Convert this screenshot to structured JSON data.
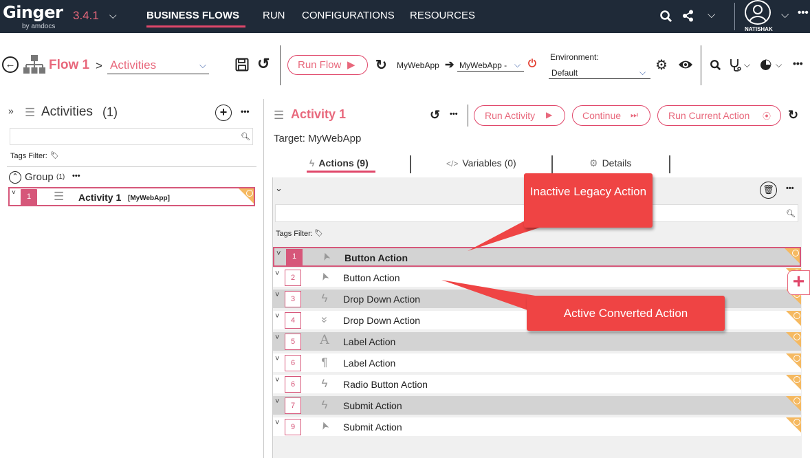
{
  "app": {
    "logo": "Ginger",
    "logo_sub": "by amdocs",
    "version": "3.4.1",
    "user": "NATISHAK"
  },
  "nav": {
    "items": [
      "BUSINESS FLOWS",
      "RUN",
      "CONFIGURATIONS",
      "RESOURCES"
    ]
  },
  "toolbar": {
    "flow_title": "Flow 1",
    "separator": ">",
    "view_select": "Activities",
    "run_flow": "Run Flow",
    "target_app": "MyWebApp",
    "agent_select": "MyWebApp -",
    "env_label": "Environment:",
    "env_value": "Default"
  },
  "activities_panel": {
    "title": "Activities",
    "count": "(1)",
    "tags_filter": "Tags Filter:",
    "group_name": "Group",
    "group_count": "(1)",
    "activity": {
      "num": "1",
      "name": "Activity 1",
      "target": "[MyWebApp]"
    }
  },
  "activity_detail": {
    "title": "Activity 1",
    "run_activity": "Run Activity",
    "continue": "Continue",
    "run_current_action": "Run Current Action",
    "target": "Target: MyWebApp",
    "tabs": {
      "actions": "Actions (9)",
      "variables": "Variables (0)",
      "details": "Details"
    },
    "tags_filter": "Tags Filter:"
  },
  "actions": [
    {
      "num": "1",
      "label": "Button Action",
      "icon": "cursor-icon",
      "style": "gray",
      "selected": true
    },
    {
      "num": "2",
      "label": "Button Action",
      "icon": "cursor-icon",
      "style": "white",
      "selected": false
    },
    {
      "num": "3",
      "label": "Drop Down Action",
      "icon": "bolt-icon",
      "style": "gray",
      "selected": false
    },
    {
      "num": "4",
      "label": "Drop Down Action",
      "icon": "double-chevron-icon",
      "style": "white",
      "selected": false
    },
    {
      "num": "5",
      "label": "Label Action",
      "icon": "letter-a-icon",
      "style": "gray",
      "selected": false
    },
    {
      "num": "6",
      "label": "Label Action",
      "icon": "pilcrow-icon",
      "style": "white",
      "selected": false
    },
    {
      "num": "6",
      "label": "Radio Button Action",
      "icon": "bolt-icon",
      "style": "white",
      "selected": false
    },
    {
      "num": "7",
      "label": "Submit Action",
      "icon": "bolt-icon",
      "style": "gray",
      "selected": false
    },
    {
      "num": "9",
      "label": "Submit Action",
      "icon": "cursor-icon",
      "style": "white",
      "selected": false
    }
  ],
  "callouts": {
    "inactive": "Inactive Legacy Action",
    "active": "Active Converted Action"
  },
  "colors": {
    "accent": "#e0476a",
    "topbar": "#1f2a38",
    "corner": "#f5b961",
    "callout": "#ef4444"
  }
}
